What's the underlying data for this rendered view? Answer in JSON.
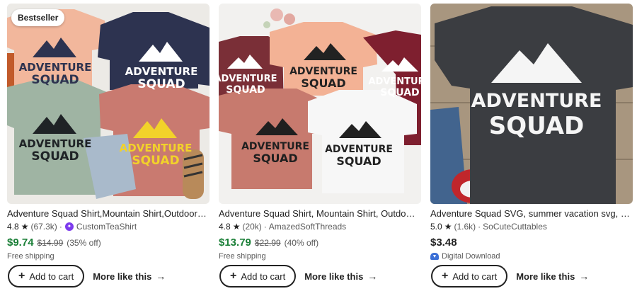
{
  "products": [
    {
      "badge": "Bestseller",
      "title": "Adventure Squad Shirt,Mountain Shirt,Outdoor Shirt",
      "rating": "4.8",
      "reviews": "(67.3k)",
      "seller": "CustomTeaShirt",
      "price": "$9.74",
      "original_price": "$14.99",
      "discount": "(35% off)",
      "shipping": "Free shipping",
      "add_to_cart": "Add to cart",
      "more_like_this": "More like this",
      "print_text": [
        "ADVENTURE",
        "SQUAD"
      ]
    },
    {
      "title": "Adventure Squad Shirt, Mountain Shirt, Outdoor Shirt",
      "rating": "4.8",
      "reviews": "(20k)",
      "seller": "AmazedSoftThreads",
      "price": "$13.79",
      "original_price": "$22.99",
      "discount": "(40% off)",
      "shipping": "Free shipping",
      "add_to_cart": "Add to cart",
      "more_like_this": "More like this",
      "print_text": [
        "ADVENTURE",
        "SQUAD"
      ]
    },
    {
      "title": "Adventure Squad SVG, summer vacation svg, camping svg",
      "rating": "5.0",
      "reviews": "(1.6k)",
      "seller": "SoCuteCuttables",
      "price": "$3.48",
      "delivery": "Digital Download",
      "add_to_cart": "Add to cart",
      "more_like_this": "More like this",
      "print_text": [
        "ADVENTURE",
        "SQUAD"
      ]
    }
  ],
  "colors": {
    "sale_price": "#1a7f37",
    "text": "#222222",
    "muted": "#595959",
    "star_seller": "#7c3aed",
    "digital_icon": "#3b6fd6"
  },
  "icons": [
    "star-icon",
    "star-seller-icon",
    "plus-icon",
    "arrow-right-icon",
    "digital-download-icon"
  ]
}
